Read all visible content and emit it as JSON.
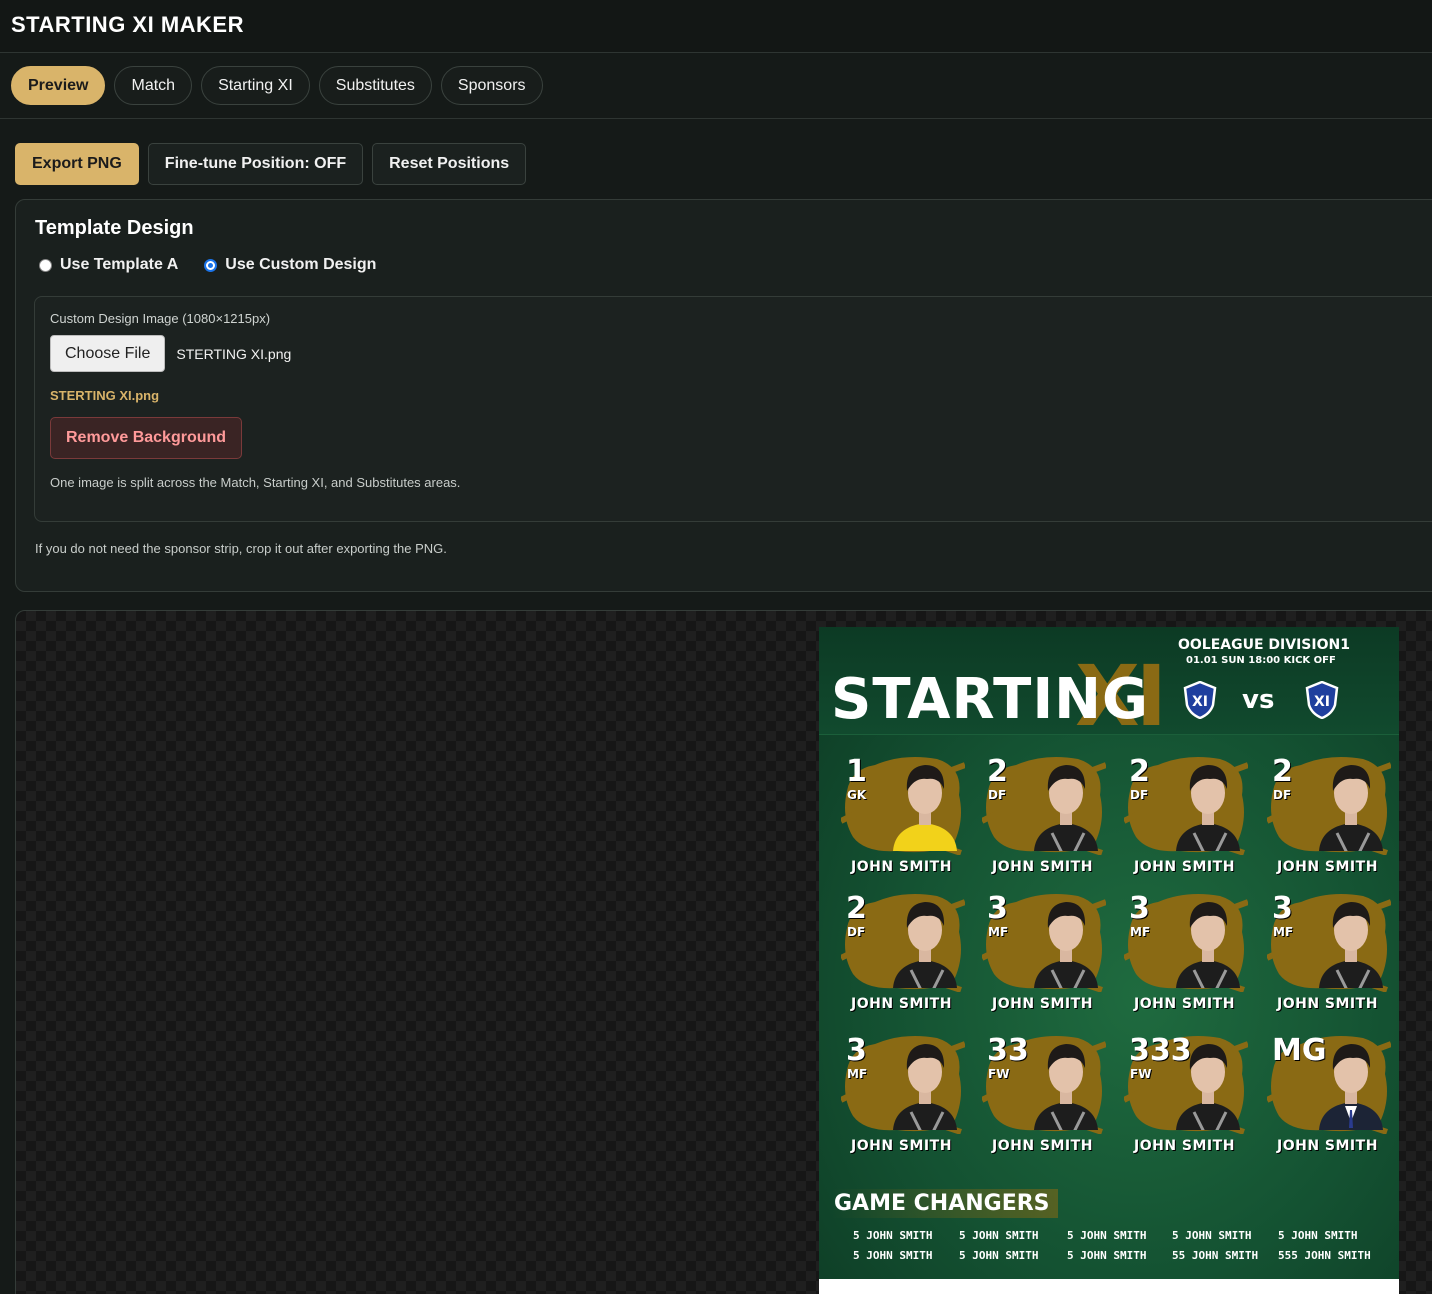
{
  "app": {
    "title": "STARTING XI MAKER"
  },
  "tabs": [
    {
      "label": "Preview",
      "active": true
    },
    {
      "label": "Match",
      "active": false
    },
    {
      "label": "Starting XI",
      "active": false
    },
    {
      "label": "Substitutes",
      "active": false
    },
    {
      "label": "Sponsors",
      "active": false
    }
  ],
  "toolbar": {
    "export_label": "Export PNG",
    "finetune_label": "Fine-tune Position: OFF",
    "reset_label": "Reset Positions"
  },
  "template": {
    "title": "Template Design",
    "option_a": "Use Template A",
    "option_custom": "Use Custom Design",
    "selected": "custom",
    "custom": {
      "field_label": "Custom Design Image (1080×1215px)",
      "choose_label": "Choose File",
      "file_name": "STERTING XI.png",
      "selected_file": "STERTING XI.png",
      "remove_bg_label": "Remove Background",
      "hint": "One image is split across the Match, Starting XI, and Substitutes areas."
    },
    "note": "If you do not need the sponsor strip, crop it out after exporting the PNG."
  },
  "poster": {
    "title": "STARTING",
    "title_xi": "XI",
    "league": "OOLEAGUE DIVISION1",
    "kickoff": "01.01 SUN 18:00 KICK OFF",
    "vs": "vs",
    "crest_home": "XI",
    "crest_away": "XI",
    "players": [
      {
        "num": "1",
        "pos": "GK",
        "name": "JOHN SMITH",
        "kit": "gk"
      },
      {
        "num": "2",
        "pos": "DF",
        "name": "JOHN SMITH",
        "kit": "field"
      },
      {
        "num": "2",
        "pos": "DF",
        "name": "JOHN SMITH",
        "kit": "field"
      },
      {
        "num": "2",
        "pos": "DF",
        "name": "JOHN SMITH",
        "kit": "field"
      },
      {
        "num": "2",
        "pos": "DF",
        "name": "JOHN SMITH",
        "kit": "field"
      },
      {
        "num": "3",
        "pos": "MF",
        "name": "JOHN SMITH",
        "kit": "field"
      },
      {
        "num": "3",
        "pos": "MF",
        "name": "JOHN SMITH",
        "kit": "field"
      },
      {
        "num": "3",
        "pos": "MF",
        "name": "JOHN SMITH",
        "kit": "field"
      },
      {
        "num": "3",
        "pos": "MF",
        "name": "JOHN SMITH",
        "kit": "field"
      },
      {
        "num": "33",
        "pos": "FW",
        "name": "JOHN SMITH",
        "kit": "field"
      },
      {
        "num": "333",
        "pos": "FW",
        "name": "JOHN SMITH",
        "kit": "field"
      },
      {
        "num": "MG",
        "pos": "",
        "name": "JOHN SMITH",
        "kit": "suit"
      }
    ],
    "subs_title": "GAME CHANGERS",
    "subs": [
      "5 JOHN SMITH",
      "5 JOHN SMITH",
      "5 JOHN SMITH",
      "5 JOHN SMITH",
      "5 JOHN SMITH",
      "5 JOHN SMITH",
      "5 JOHN SMITH",
      "5 JOHN SMITH",
      "55 JOHN SMITH",
      "555 JOHN SMITH"
    ]
  },
  "colors": {
    "accent": "#d9b46a",
    "background": "#151a18",
    "poster_green": "#145232",
    "splash_gold": "#8a6a14",
    "danger_text": "#ff9a9a"
  },
  "icons": {
    "crest": "shield-xi-icon",
    "checkerboard": "transparency-grid"
  }
}
